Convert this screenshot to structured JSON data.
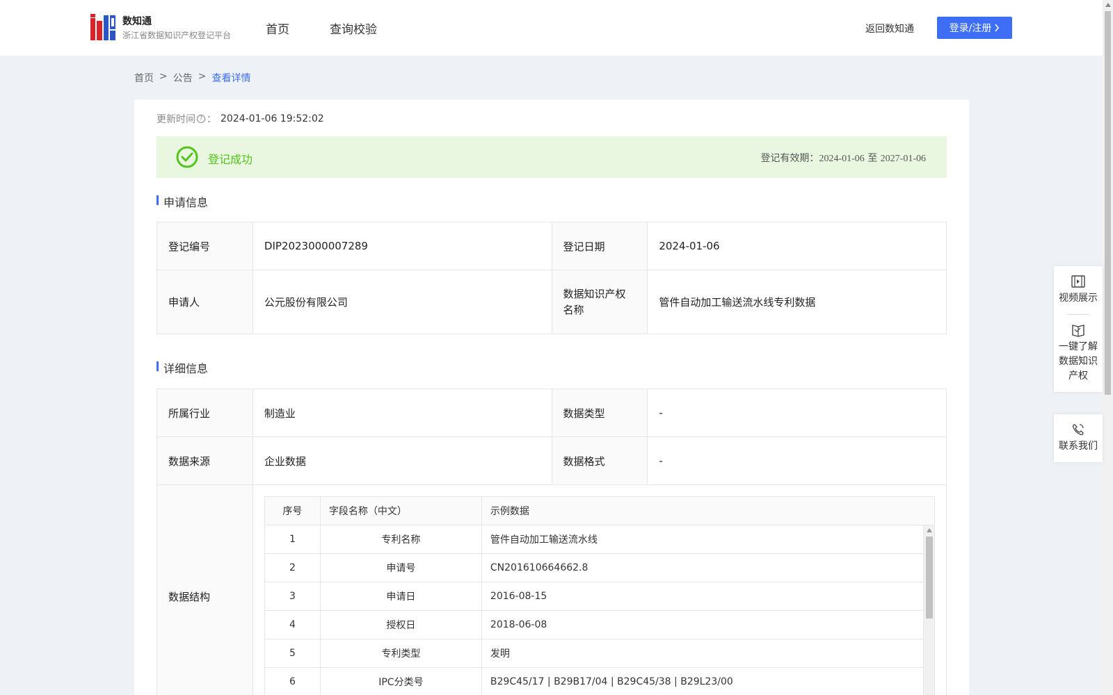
{
  "header": {
    "brand_name": "数知通",
    "brand_sub": "浙江省数据知识产权登记平台",
    "nav": [
      "首页",
      "查询校验"
    ],
    "back_link": "返回数知通",
    "login_label": "登录/注册",
    "brand_color": "#3d6ef5"
  },
  "breadcrumb": {
    "home": "首页",
    "sep": ">",
    "notice": "公告",
    "current": "查看详情"
  },
  "update": {
    "label": "更新时间",
    "help_glyph": "?",
    "colon": "：",
    "value": "2024-01-06 19:52:02"
  },
  "status": {
    "text": "登记成功",
    "validity_label": "登记有效期：",
    "validity_start": "2024-01-06",
    "validity_to": "至",
    "validity_end": "2027-01-06",
    "color": "#52c41a"
  },
  "application": {
    "title": "申请信息",
    "reg_no_label": "登记编号",
    "reg_no": "DIP2023000007289",
    "reg_date_label": "登记日期",
    "reg_date": "2024-01-06",
    "applicant_label": "申请人",
    "applicant": "公元股份有限公司",
    "ip_name_label": "数据知识产权名称",
    "ip_name": "管件自动加工输送流水线专利数据"
  },
  "detail": {
    "title": "详细信息",
    "industry_label": "所属行业",
    "industry": "制造业",
    "data_type_label": "数据类型",
    "data_type": "-",
    "source_label": "数据来源",
    "source": "企业数据",
    "format_label": "数据格式",
    "format": "-",
    "structure_label": "数据结构",
    "structure_headers": [
      "序号",
      "字段名称（中文）",
      "示例数据"
    ],
    "structure_rows": [
      {
        "idx": "1",
        "name": "专利名称",
        "sample": "管件自动加工输送流水线"
      },
      {
        "idx": "2",
        "name": "申请号",
        "sample": "CN201610664662.8"
      },
      {
        "idx": "3",
        "name": "申请日",
        "sample": "2016-08-15"
      },
      {
        "idx": "4",
        "name": "授权日",
        "sample": "2018-06-08"
      },
      {
        "idx": "5",
        "name": "专利类型",
        "sample": "发明"
      },
      {
        "idx": "6",
        "name": "IPC分类号",
        "sample": "B29C45/17 | B29B17/04 | B29C45/38 | B29L23/00"
      }
    ]
  },
  "float_panel": {
    "video": "视频展示",
    "learn": "一键了解数据知识产权",
    "contact": "联系我们"
  }
}
